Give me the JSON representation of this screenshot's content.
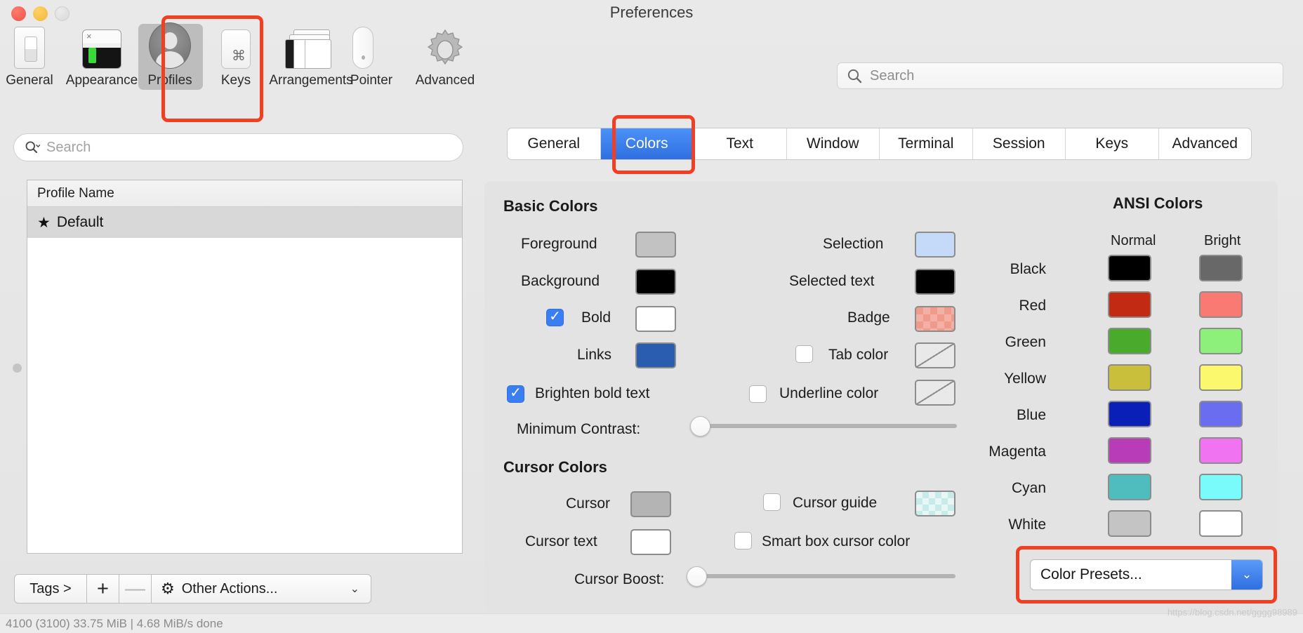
{
  "window": {
    "title": "Preferences",
    "traffic_lights": [
      "close",
      "minimize",
      "zoom"
    ]
  },
  "toolbar": {
    "search_placeholder": "Search",
    "items": [
      {
        "label": "General",
        "icon": "general-icon",
        "selected": false
      },
      {
        "label": "Appearance",
        "icon": "appearance-icon",
        "selected": false
      },
      {
        "label": "Profiles",
        "icon": "profile-icon",
        "selected": true
      },
      {
        "label": "Keys",
        "icon": "keyboard-key-icon",
        "selected": false
      },
      {
        "label": "Arrangements",
        "icon": "arrangements-icon",
        "selected": false
      },
      {
        "label": "Pointer",
        "icon": "mouse-icon",
        "selected": false
      },
      {
        "label": "Advanced",
        "icon": "gear-icon",
        "selected": false
      }
    ]
  },
  "sidebar": {
    "search_placeholder": "Search",
    "table_header": "Profile Name",
    "rows": [
      {
        "name": "Default",
        "default": true,
        "selected": true
      }
    ],
    "footer": {
      "tags_label": "Tags >",
      "add_label": "+",
      "remove_label": "—",
      "other_actions_label": "Other Actions...",
      "other_actions_caret": "⌄"
    }
  },
  "tabs": [
    {
      "label": "General",
      "active": false
    },
    {
      "label": "Colors",
      "active": true
    },
    {
      "label": "Text",
      "active": false
    },
    {
      "label": "Window",
      "active": false
    },
    {
      "label": "Terminal",
      "active": false
    },
    {
      "label": "Session",
      "active": false
    },
    {
      "label": "Keys",
      "active": false
    },
    {
      "label": "Advanced",
      "active": false
    }
  ],
  "basic_colors": {
    "title": "Basic Colors",
    "left": [
      {
        "label": "Foreground",
        "color": "#c2c2c2",
        "kind": "solid",
        "checkbox": null
      },
      {
        "label": "Background",
        "color": "#000000",
        "kind": "solid",
        "checkbox": null
      },
      {
        "label": "Bold",
        "color": "#ffffff",
        "kind": "solid",
        "checkbox": true
      },
      {
        "label": "Links",
        "color": "#2a5db0",
        "kind": "solid",
        "checkbox": null
      }
    ],
    "right": [
      {
        "label": "Selection",
        "color": "#c4daf8",
        "kind": "solid",
        "checkbox": null
      },
      {
        "label": "Selected text",
        "color": "#000000",
        "kind": "solid",
        "checkbox": null
      },
      {
        "label": "Badge",
        "color": "#f09a8c",
        "kind": "checker",
        "checkbox": null
      },
      {
        "label": "Tab color",
        "color": "",
        "kind": "none",
        "checkbox": false
      }
    ],
    "brighten_bold_label": "Brighten bold text",
    "brighten_bold_checked": true,
    "underline_color_label": "Underline color",
    "underline_color_checked": false,
    "minimum_contrast_label": "Minimum Contrast:",
    "minimum_contrast_value": 0
  },
  "cursor_colors": {
    "title": "Cursor Colors",
    "left": [
      {
        "label": "Cursor",
        "color": "#b4b4b4",
        "kind": "solid"
      },
      {
        "label": "Cursor text",
        "color": "#ffffff",
        "kind": "solid"
      }
    ],
    "right": [
      {
        "label": "Cursor guide",
        "kind": "guide",
        "checked": false
      },
      {
        "label": "Smart box cursor color",
        "kind": "text",
        "checked": false
      }
    ],
    "cursor_boost_label": "Cursor Boost:",
    "cursor_boost_value": 0
  },
  "ansi_colors": {
    "title": "ANSI Colors",
    "col_normal": "Normal",
    "col_bright": "Bright",
    "rows": [
      {
        "name": "Black",
        "normal": "#000000",
        "bright": "#686868"
      },
      {
        "name": "Red",
        "normal": "#c22a13",
        "bright": "#f97a72"
      },
      {
        "name": "Green",
        "normal": "#4aaa2c",
        "bright": "#8cf07a"
      },
      {
        "name": "Yellow",
        "normal": "#c9bf3b",
        "bright": "#fbf86e"
      },
      {
        "name": "Blue",
        "normal": "#0a1fb8",
        "bright": "#6a6df0"
      },
      {
        "name": "Magenta",
        "normal": "#b83bb8",
        "bright": "#f073f2"
      },
      {
        "name": "Cyan",
        "normal": "#4fbcbe",
        "bright": "#79fbfb"
      },
      {
        "name": "White",
        "normal": "#c4c4c4",
        "bright": "#ffffff"
      }
    ]
  },
  "color_presets": {
    "label": "Color Presets...",
    "caret": "⌄"
  },
  "annotations": {
    "accent": "#f03f22",
    "highlighted": [
      "profiles-toolbar-item",
      "colors-tab",
      "color-presets-dropdown"
    ]
  },
  "status": {
    "text": "4100 (3100)   33.75 MiB  |  4.68 MiB/s   done"
  },
  "watermark": "https://blog.csdn.net/gggg98989"
}
